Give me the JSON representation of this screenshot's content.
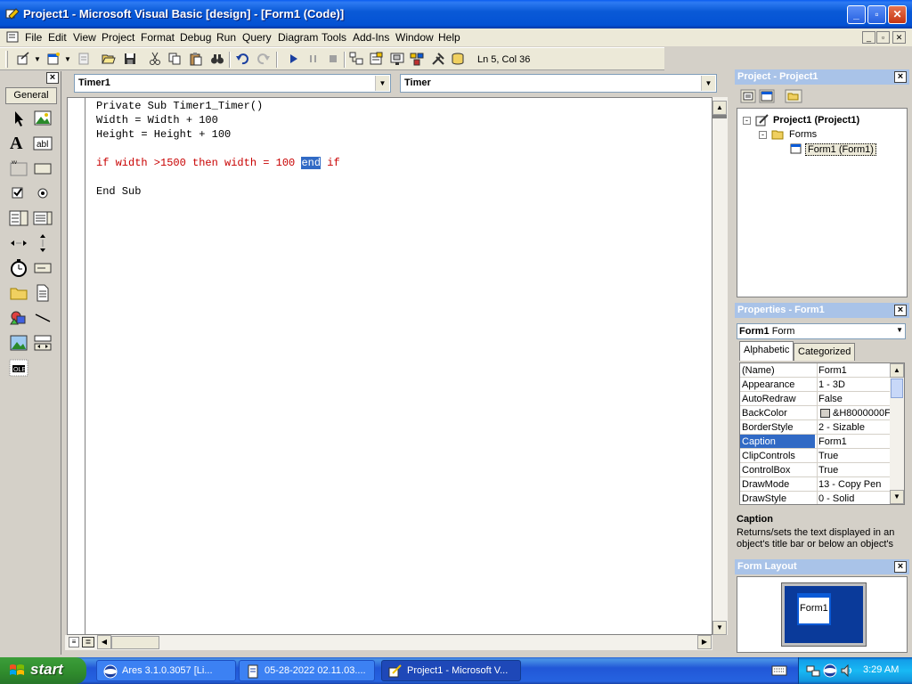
{
  "window": {
    "title": "Project1 - Microsoft Visual Basic [design] - [Form1 (Code)]",
    "caption_buttons": [
      "minimize",
      "maximize",
      "close"
    ]
  },
  "menubar": {
    "items": [
      "File",
      "Edit",
      "View",
      "Project",
      "Format",
      "Debug",
      "Run",
      "Query",
      "Diagram",
      "Tools",
      "Add-Ins",
      "Window",
      "Help"
    ]
  },
  "toolbar": {
    "icons": [
      "add-project-icon",
      "add-form-icon",
      "menu-editor-icon",
      "open-icon",
      "save-icon",
      "cut-icon",
      "copy-icon",
      "paste-icon",
      "find-icon",
      "undo-icon",
      "redo-icon",
      "run-icon",
      "pause-icon",
      "stop-icon",
      "project-explorer-icon",
      "properties-icon",
      "form-layout-icon",
      "object-browser-icon",
      "toolbox-icon",
      "data-view-icon"
    ],
    "position": "Ln 5, Col 36"
  },
  "toolbox": {
    "tab_label": "General",
    "tools": [
      "pointer",
      "picturebox",
      "label",
      "textbox",
      "frame",
      "commandbutton",
      "checkbox",
      "optionbutton",
      "combobox",
      "listbox",
      "hscrollbar",
      "vscrollbar",
      "timer",
      "drivelistbox",
      "dirlistbox",
      "filelistbox",
      "shape",
      "line",
      "image",
      "data",
      "ole"
    ]
  },
  "code": {
    "object_combo": "Timer1",
    "procedure_combo": "Timer",
    "lines": [
      {
        "text": "Private Sub Timer1_Timer()",
        "error": false
      },
      {
        "text": "Width = Width + 100",
        "error": false
      },
      {
        "text": "Height = Height + 100",
        "error": false
      },
      {
        "text": "",
        "error": false
      },
      {
        "text": "if width >1500 then width = 100 ",
        "error": true,
        "selected": "end",
        "after": " if"
      },
      {
        "text": "",
        "error": false
      },
      {
        "text": "End Sub",
        "error": false
      }
    ]
  },
  "project": {
    "title": "Project - Project1",
    "root": "Project1 (Project1)",
    "folder": "Forms",
    "item": "Form1 (Form1)"
  },
  "properties": {
    "title": "Properties - Form1",
    "object": "Form1",
    "object_type": "Form",
    "tabs": [
      "Alphabetic",
      "Categorized"
    ],
    "rows": [
      {
        "name": "(Name)",
        "value": "Form1"
      },
      {
        "name": "Appearance",
        "value": "1 - 3D"
      },
      {
        "name": "AutoRedraw",
        "value": "False"
      },
      {
        "name": "BackColor",
        "value": "&H8000000F"
      },
      {
        "name": "BorderStyle",
        "value": "2 - Sizable"
      },
      {
        "name": "Caption",
        "value": "Form1"
      },
      {
        "name": "ClipControls",
        "value": "True"
      },
      {
        "name": "ControlBox",
        "value": "True"
      },
      {
        "name": "DrawMode",
        "value": "13 - Copy Pen"
      },
      {
        "name": "DrawStyle",
        "value": "0 - Solid"
      }
    ],
    "selected_row": "Caption",
    "desc_title": "Caption",
    "desc_text": "Returns/sets the text displayed in an object's title bar or below an object's"
  },
  "form_layout": {
    "title": "Form Layout",
    "form_label": "Form1"
  },
  "taskbar": {
    "start_label": "start",
    "tasks": [
      {
        "label": "Ares 3.1.0.3057   [Li...",
        "active": false
      },
      {
        "label": "05-28-2022 02.11.03....",
        "active": false
      },
      {
        "label": "Project1 - Microsoft V...",
        "active": true
      }
    ],
    "clock": "3:29 AM"
  },
  "colors": {
    "title_blue": "#0a5ad7",
    "error_red": "#c80000",
    "selection": "#316ac5",
    "start_green": "#2f8b2c"
  }
}
